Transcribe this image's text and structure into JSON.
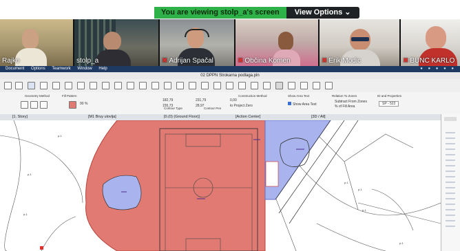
{
  "banner": {
    "viewing_text": "You are viewing stolp_a's screen",
    "view_options": "View Options ⌄"
  },
  "participants": [
    {
      "name": "Rajko",
      "muted": false
    },
    {
      "name": "stolp_a",
      "muted": false
    },
    {
      "name": "Adrijan Spačal",
      "muted": true
    },
    {
      "name": "Občina Komen",
      "muted": true
    },
    {
      "name": "Erik Modic",
      "muted": true
    },
    {
      "name": "BUNC KARLO",
      "muted": true
    }
  ],
  "menu": {
    "items": [
      "Document",
      "Options",
      "Teamwork",
      "Window",
      "Help"
    ]
  },
  "app": {
    "title": "02 DPPN Strokarna podlaga.pln"
  },
  "toolbar": {
    "geometry_method": "Geometry Method",
    "fill_pattern": "Fill Pattern",
    "percent": "90 %",
    "coord_a": "182,79",
    "coord_b": "155,73",
    "coord_c": "231,79",
    "coord_d": "28,97",
    "contour_type": "Contour Type",
    "contour_pen": "Contour Pen",
    "construction_method": "Construction Method",
    "show_area_text_label": "Show Area Text",
    "show_area_text": "Show Area Text",
    "relation_to_zones": "Relation To Zones",
    "subtract_zones": "Subtract From Zones",
    "fill_area": "% of Fill Area",
    "id_properties": "ID and Properties",
    "id_value": "SP - 522",
    "project_zero_value": "0,00",
    "project_zero": "to Project Zero"
  },
  "tabs": [
    "[1. Story]",
    "[M1 Bruy ulovlja]",
    "[0.(0) (Ground Floor)]",
    "[Action Center]",
    "[3D / All]"
  ],
  "colors": {
    "red_fill": "#e07a72",
    "blue_fill": "#a9b4ee",
    "accent": "#2fb14a"
  }
}
